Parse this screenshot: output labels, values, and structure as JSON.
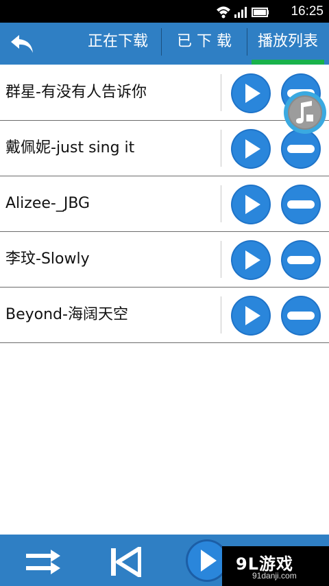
{
  "status_bar": {
    "time": "16:25"
  },
  "header": {
    "tabs": [
      {
        "label": "正在下载",
        "active": false
      },
      {
        "label": "已 下 载",
        "active": false
      },
      {
        "label": "播放列表",
        "active": true
      }
    ]
  },
  "playlist": [
    {
      "title": "群星-有没有人告诉你"
    },
    {
      "title": "戴佩妮-just sing it"
    },
    {
      "title": "Alizee-_JBG"
    },
    {
      "title": "李玟-Slowly"
    },
    {
      "title": "Beyond-海阔天空"
    }
  ],
  "watermark": {
    "main": "9L游戏",
    "sub": "91danji.com"
  },
  "colors": {
    "bar_blue": "#2f7fc4",
    "active_indicator": "#19b24a",
    "button_blue": "#1e73c8"
  },
  "icons": {
    "back": "back-arrow-icon",
    "play": "play-icon",
    "remove": "minus-icon",
    "shuffle": "shuffle-icon",
    "previous": "previous-icon",
    "music": "music-note-icon"
  }
}
